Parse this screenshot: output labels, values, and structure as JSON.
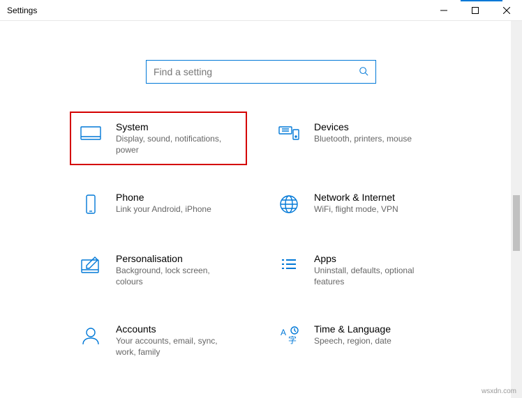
{
  "window": {
    "title": "Settings",
    "accent_color": "#0078d7"
  },
  "search": {
    "placeholder": "Find a setting"
  },
  "categories": [
    {
      "id": "system",
      "title": "System",
      "subtitle": "Display, sound, notifications, power",
      "highlighted": true
    },
    {
      "id": "devices",
      "title": "Devices",
      "subtitle": "Bluetooth, printers, mouse",
      "highlighted": false
    },
    {
      "id": "phone",
      "title": "Phone",
      "subtitle": "Link your Android, iPhone",
      "highlighted": false
    },
    {
      "id": "network",
      "title": "Network & Internet",
      "subtitle": "WiFi, flight mode, VPN",
      "highlighted": false
    },
    {
      "id": "personalisation",
      "title": "Personalisation",
      "subtitle": "Background, lock screen, colours",
      "highlighted": false
    },
    {
      "id": "apps",
      "title": "Apps",
      "subtitle": "Uninstall, defaults, optional features",
      "highlighted": false
    },
    {
      "id": "accounts",
      "title": "Accounts",
      "subtitle": "Your accounts, email, sync, work, family",
      "highlighted": false
    },
    {
      "id": "time",
      "title": "Time & Language",
      "subtitle": "Speech, region, date",
      "highlighted": false
    }
  ],
  "watermark": "wsxdn.com"
}
